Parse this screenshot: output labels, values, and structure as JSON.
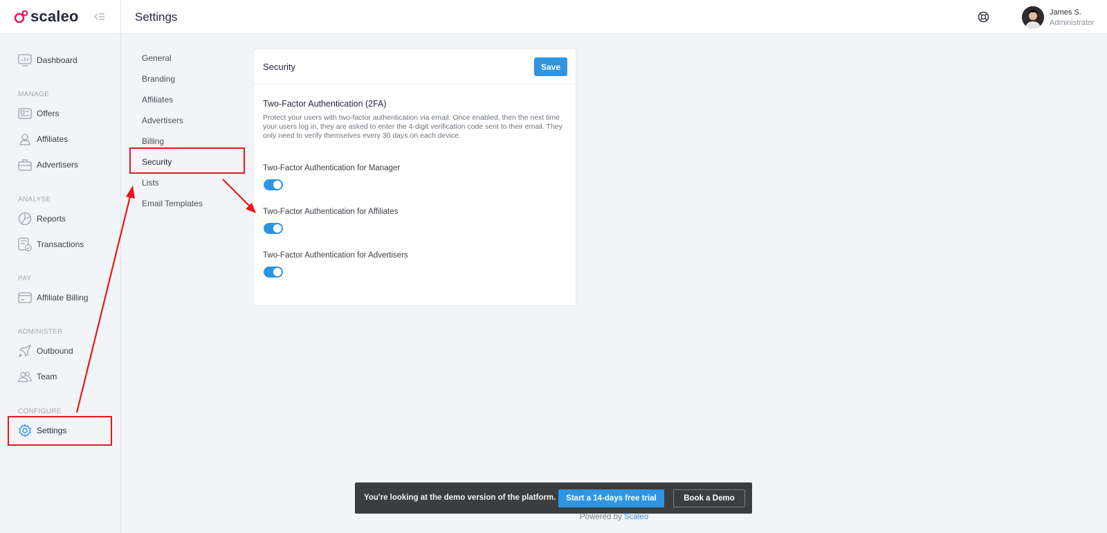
{
  "app": {
    "logo_text": "scaleo",
    "page_title": "Settings"
  },
  "user": {
    "name": "James S.",
    "role": "Administrator"
  },
  "sidebar": {
    "dashboard": "Dashboard",
    "sections": {
      "manage": "MANAGE",
      "analyse": "ANALYSE",
      "pay": "PAY",
      "administer": "ADMINISTER",
      "configure": "CONFIGURE"
    },
    "items": {
      "offers": "Offers",
      "affiliates": "Affiliates",
      "advertisers": "Advertisers",
      "reports": "Reports",
      "transactions": "Transactions",
      "affiliate_billing": "Affiliate Billing",
      "outbound": "Outbound",
      "team": "Team",
      "settings": "Settings"
    }
  },
  "subnav": {
    "items": [
      "General",
      "Branding",
      "Affiliates",
      "Advertisers",
      "Billing",
      "Security",
      "Lists",
      "Email Templates"
    ],
    "active": "Security"
  },
  "card": {
    "title": "Security",
    "save_label": "Save",
    "section_title": "Two-Factor Authentication (2FA)",
    "description": "Protect your users with two-factor authentication via email. Once enabled, then the next time your users log in, they are asked to enter the 4-digit verification code sent to their email. They only need to verify themselves every 30 days on each device.",
    "toggles": [
      {
        "label": "Two-Factor Authentication for Manager",
        "enabled": true
      },
      {
        "label": "Two-Factor Authentication for Affiliates",
        "enabled": true
      },
      {
        "label": "Two-Factor Authentication for Advertisers",
        "enabled": true
      }
    ]
  },
  "banner": {
    "text": "You're looking at the demo version of the platform.",
    "trial_label": "Start a 14-days free trial",
    "demo_label": "Book a Demo"
  },
  "footer": {
    "powered_prefix": "Powered by",
    "powered_link": "Scaleo"
  },
  "colors": {
    "accent": "#2f95e3",
    "annotation_red": "#e8161b",
    "brand_pink": "#e5195e"
  },
  "icons": [
    "scaleo-logo-icon",
    "collapse-sidebar-icon",
    "dashboard-icon",
    "offers-icon",
    "user-icon",
    "briefcase-icon",
    "globe-icon",
    "transactions-icon",
    "card-icon",
    "rocket-icon",
    "team-icon",
    "gear-icon",
    "help-lifebuoy-icon"
  ]
}
